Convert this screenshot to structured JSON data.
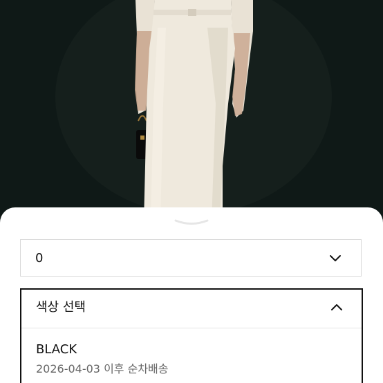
{
  "quantity_select": {
    "value": "0"
  },
  "color_dropdown": {
    "title": "색상 선택",
    "options": [
      {
        "name": "BLACK",
        "availability": "2026-04-03 이후 순차배송"
      }
    ]
  },
  "icons": {
    "select_toggle": "chevron-down-icon",
    "dropdown_toggle": "chevron-up-icon",
    "sheet_handle": "sheet-grabber"
  },
  "colors": {
    "photo_background": "#0f1917",
    "dress": "#efe9dd",
    "sheet_background": "#ffffff",
    "active_border": "#111111"
  }
}
